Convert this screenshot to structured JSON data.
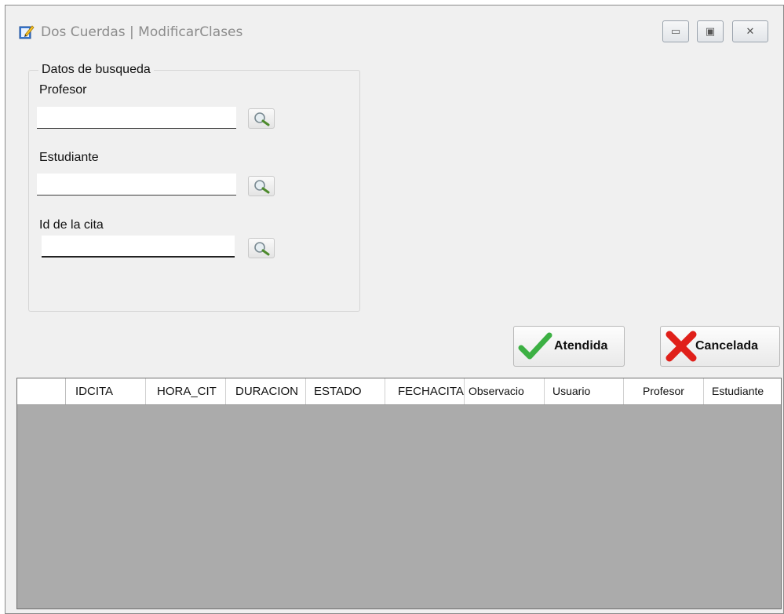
{
  "window": {
    "title": "Dos Cuerdas | ModificarClases",
    "controls": {
      "minimize": "▭",
      "maximize": "▣",
      "close": "✕"
    }
  },
  "search_group": {
    "title": "Datos de busqueda",
    "fields": [
      {
        "label": "Profesor",
        "value": ""
      },
      {
        "label": "Estudiante",
        "value": ""
      },
      {
        "label": "Id de la cita",
        "value": ""
      }
    ]
  },
  "actions": {
    "attended_label": "Atendida",
    "cancelled_label": "Cancelada"
  },
  "grid": {
    "columns": [
      "IDCITA",
      "HORA_CIT",
      "DURACION",
      "ESTADO",
      "FECHACITA",
      "Observacio",
      "Usuario",
      "Profesor",
      "Estudiante"
    ],
    "rows": []
  },
  "colors": {
    "window_bg": "#f0f0f0",
    "grid_bg": "#ababab",
    "accept_green": "#3cb043",
    "cancel_red": "#e0201a"
  },
  "icons": [
    "edit-app-icon",
    "magnifier-icon",
    "check-icon",
    "x-icon"
  ]
}
